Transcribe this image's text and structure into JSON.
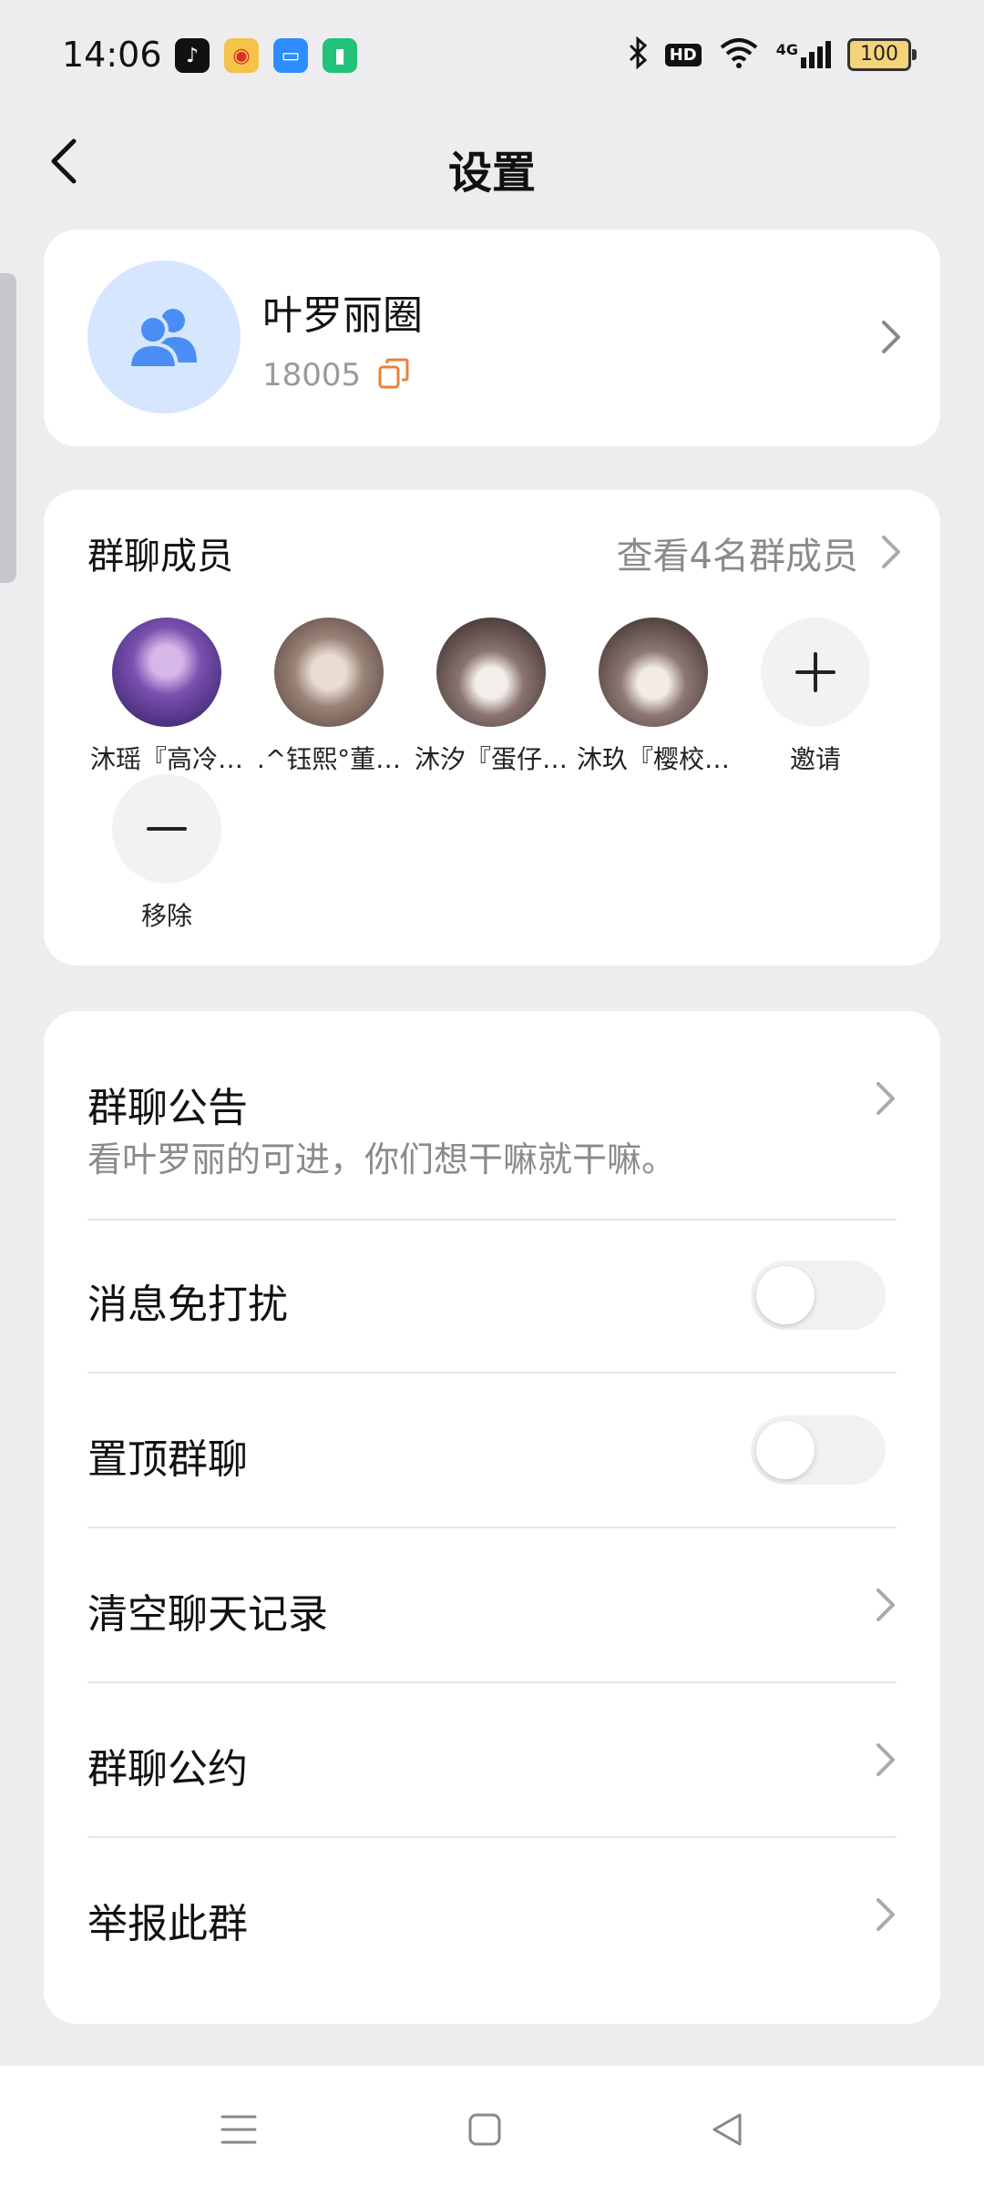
{
  "status_bar": {
    "time": "14:06",
    "app_icons": [
      "tiktok-icon",
      "weibo-icon",
      "files-icon",
      "battery-saver-icon"
    ],
    "indicators": [
      "bluetooth-icon",
      "hd-icon",
      "wifi-icon",
      "4g-signal-icon"
    ],
    "hd_label": "HD",
    "net_label": "4G",
    "battery_level": "100"
  },
  "header": {
    "title": "设置"
  },
  "group": {
    "name": "叶罗丽圈",
    "id": "18005"
  },
  "members": {
    "title": "群聊成员",
    "view_all": "查看4名群成员",
    "list": [
      {
        "name": "沐瑶『高冷…",
        "avatar_color": "#3a2a6e"
      },
      {
        "name": ".^钰熙°董…",
        "avatar_color": "#6d5a52"
      },
      {
        "name": "沐汐『蛋仔…",
        "avatar_color": "#3b2b2a"
      },
      {
        "name": "沐玖『樱校…",
        "avatar_color": "#3e302e"
      }
    ],
    "invite_label": "邀请",
    "remove_label": "移除"
  },
  "settings": {
    "announcement_label": "群聊公告",
    "announcement_text": "看叶罗丽的可进，你们想干嘛就干嘛。",
    "dnd_label": "消息免打扰",
    "dnd_on": false,
    "pin_label": "置顶群聊",
    "pin_on": false,
    "clear_label": "清空聊天记录",
    "rules_label": "群聊公约",
    "report_label": "举报此群"
  },
  "colors": {
    "accent": "#4a8ef5",
    "avatar_bg": "#d6e6ff",
    "copy_icon": "#e8823a"
  }
}
